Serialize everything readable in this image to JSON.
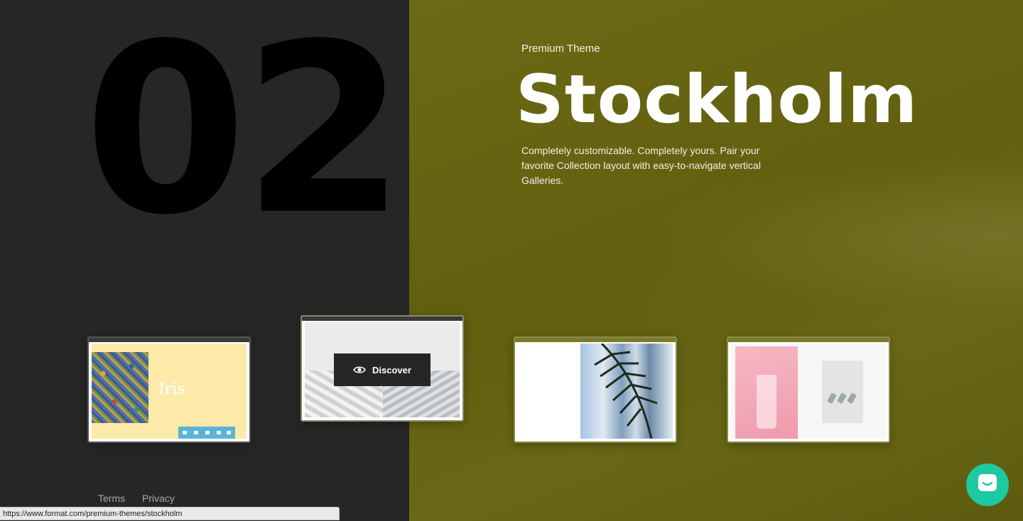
{
  "hero": {
    "number": "02",
    "eyebrow": "Premium Theme",
    "title": "Stockholm",
    "description": "Completely customizable. Completely yours. Pair your favorite Collection layout with easy-to-navigate vertical Galleries."
  },
  "thumbnails": {
    "iris": {
      "word": "Iris"
    },
    "stockholm": {
      "button_label": "Discover"
    }
  },
  "footer": {
    "terms": "Terms",
    "privacy": "Privacy"
  },
  "status_bar": {
    "url": "https://www.format.com/premium-themes/stockholm"
  },
  "colors": {
    "left_bg": "#262626",
    "right_bg": "#676514",
    "chat_accent": "#1dc9a0"
  },
  "icons": {
    "discover": "eye-icon",
    "chat": "chat-icon"
  }
}
